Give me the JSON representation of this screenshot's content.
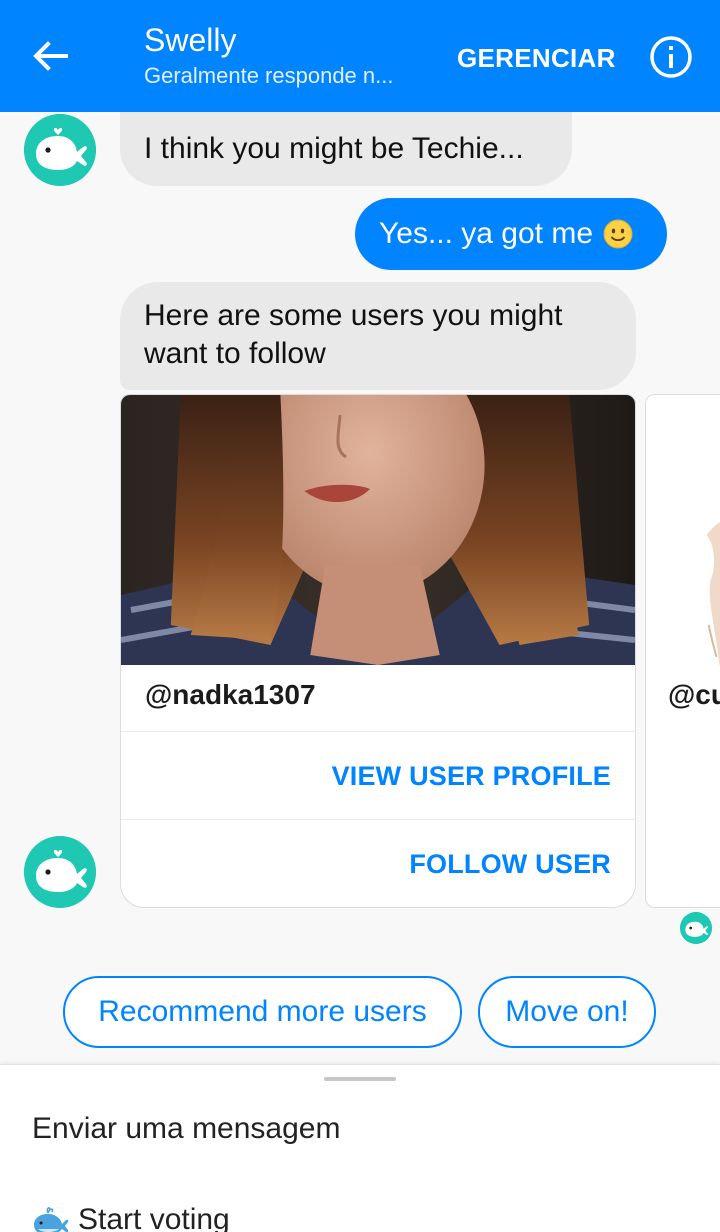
{
  "header": {
    "title": "Swelly",
    "subtitle": "Geralmente responde n...",
    "manage_label": "GERENCIAR",
    "back_icon": "arrow-left-icon",
    "info_icon": "info-icon",
    "background_color": "#0084ff"
  },
  "messages": [
    {
      "from": "bot",
      "text": "I think you might be Techie..."
    },
    {
      "from": "user",
      "text": "Yes... ya got me",
      "emoji": "slightly-smiling-face"
    },
    {
      "from": "bot",
      "text": "Here are some users you might want to follow"
    }
  ],
  "cards": [
    {
      "handle": "@nadka1307",
      "actions": [
        "VIEW USER PROFILE",
        "FOLLOW USER"
      ]
    },
    {
      "handle": "@cu"
    }
  ],
  "quick_replies": [
    "Recommend more users",
    "Move on!"
  ],
  "composer": {
    "placeholder": "Enviar uma mensagem",
    "menu_item": "Start voting",
    "menu_item_icon": "whale-icon"
  },
  "colors": {
    "accent": "#0084ff",
    "bot_avatar": "#1fc8b3",
    "incoming_bubble": "#e9e9ea"
  }
}
